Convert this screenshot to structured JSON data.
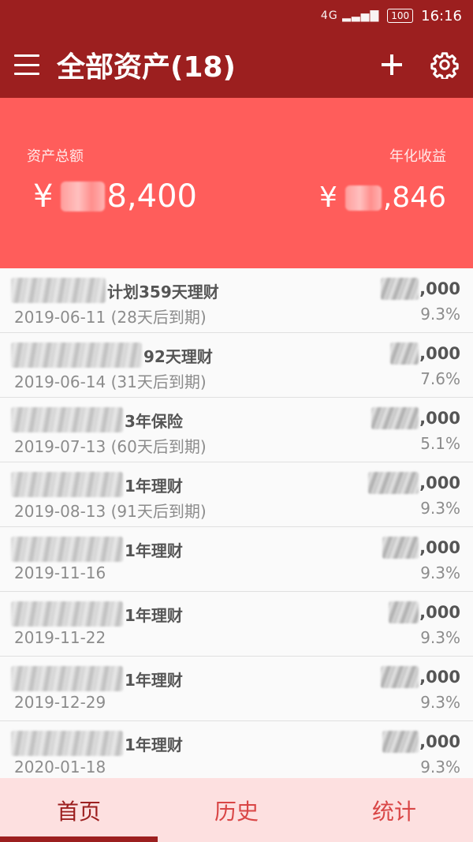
{
  "status_bar": {
    "signal": "4G",
    "battery": "100",
    "time": "16:16"
  },
  "app_bar": {
    "title": "全部资产(18)"
  },
  "summary": {
    "total_label": "资产总额",
    "total_currency": "¥",
    "total_visible_suffix": "8,400",
    "income_label": "年化收益",
    "income_currency": "¥",
    "income_visible_suffix": ",846"
  },
  "items": [
    {
      "title_suffix": "计划359天理财",
      "date": "2019-06-11 (28天后到期)",
      "amount_suffix": ",000",
      "rate": "9.3%"
    },
    {
      "title_suffix": "92天理财",
      "date": "2019-06-14 (31天后到期)",
      "amount_suffix": ",000",
      "rate": "7.6%"
    },
    {
      "title_suffix": "3年保险",
      "date": "2019-07-13 (60天后到期)",
      "amount_suffix": ",000",
      "rate": "5.1%"
    },
    {
      "title_suffix": "1年理财",
      "date": "2019-08-13 (91天后到期)",
      "amount_suffix": ",000",
      "rate": "9.3%"
    },
    {
      "title_suffix": "1年理财",
      "date": "2019-11-16",
      "amount_suffix": ",000",
      "rate": "9.3%"
    },
    {
      "title_suffix": "1年理财",
      "date": "2019-11-22",
      "amount_suffix": ",000",
      "rate": "9.3%"
    },
    {
      "title_suffix": "1年理财",
      "date": "2019-12-29",
      "amount_suffix": ",000",
      "rate": "9.3%"
    },
    {
      "title_suffix": "1年理财",
      "date": "2020-01-18",
      "amount_suffix": ",000",
      "rate": "9.3%"
    }
  ],
  "nav": {
    "tabs": [
      {
        "label": "首页",
        "active": true
      },
      {
        "label": "历史",
        "active": false
      },
      {
        "label": "统计",
        "active": false
      }
    ]
  },
  "colors": {
    "primary": "#9c1f1f",
    "summary_bg": "#ff5d5b",
    "nav_bg": "#fde0e0"
  }
}
